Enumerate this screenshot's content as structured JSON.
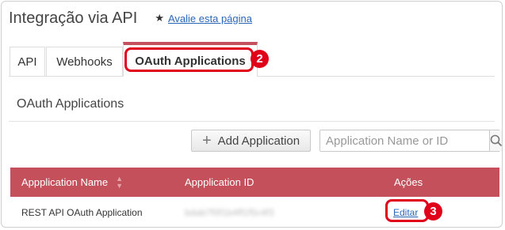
{
  "header": {
    "title": "Integração via API",
    "rate_label": "Avalie esta página"
  },
  "tabs": [
    {
      "label": "API"
    },
    {
      "label": "Webhooks"
    },
    {
      "label": "OAuth Applications",
      "active": true
    }
  ],
  "callouts": {
    "tab_badge": "2",
    "edit_badge": "3"
  },
  "section": {
    "title": "OAuth Applications"
  },
  "toolbar": {
    "add_label": "Add Application",
    "search_placeholder": "Application Name or ID"
  },
  "table": {
    "columns": [
      "Appplication Name",
      "Appplication ID",
      "Ações"
    ],
    "rows": [
      {
        "name": "REST API OAuth Application",
        "id": "bdab7f0f1b4ff1f5c4f3",
        "action": "Editar"
      }
    ]
  },
  "colors": {
    "accent": "#c4505c",
    "callout": "#e0001a",
    "link": "#2b67b8"
  },
  "icons": [
    "star-icon",
    "plus-icon",
    "search-icon",
    "sort-icon"
  ]
}
